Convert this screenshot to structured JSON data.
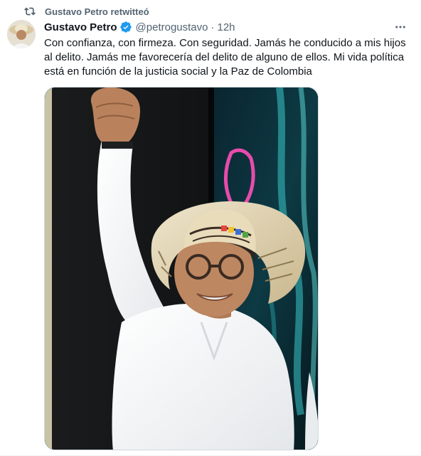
{
  "retweet": {
    "label": "Gustavo Petro retwitteó",
    "icon": "retweet-icon"
  },
  "author": {
    "display_name": "Gustavo Petro",
    "handle": "@petrogustavo",
    "separator": "·",
    "time": "12h",
    "verified_icon": "verified-badge-icon",
    "verified_color": "#1d9bf0"
  },
  "tweet": {
    "text": "Con confianza, con firmeza. Con seguridad. Jamás he conducido a mis hijos al delito. Jamás me favorecería del delito de alguno de ellos. Mi vida política está en función de la justicia social y la Paz de Colombia"
  },
  "more_icon": "more-horizontal-icon",
  "colors": {
    "secondary_text": "#536471",
    "primary_text": "#0f1419",
    "border": "#cfd9de"
  }
}
